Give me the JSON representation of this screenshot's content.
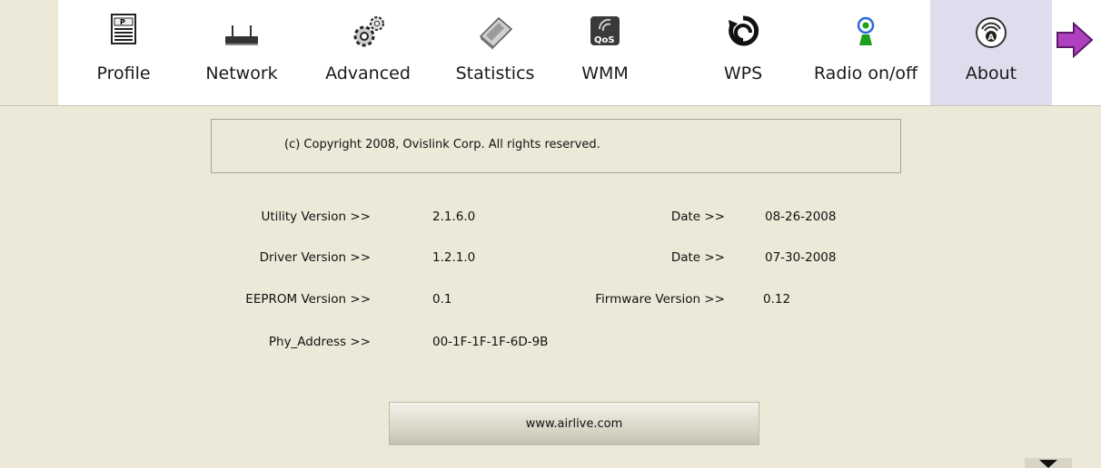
{
  "toolbar": {
    "items": [
      {
        "label": "Profile"
      },
      {
        "label": "Network"
      },
      {
        "label": "Advanced"
      },
      {
        "label": "Statistics"
      },
      {
        "label": "WMM"
      },
      {
        "label": "WPS"
      },
      {
        "label": "Radio on/off"
      },
      {
        "label": "About"
      }
    ],
    "selected": "About",
    "qos_badge": "QoS",
    "profile_badge": "P"
  },
  "about": {
    "copyright": "(c) Copyright 2008, Ovislink Corp. All rights reserved.",
    "utility_version_label": "Utility Version >>",
    "utility_version": "2.1.6.0",
    "utility_date_label": "Date >>",
    "utility_date": "08-26-2008",
    "driver_version_label": "Driver Version >>",
    "driver_version": "1.2.1.0",
    "driver_date_label": "Date >>",
    "driver_date": "07-30-2008",
    "eeprom_version_label": "EEPROM Version >>",
    "eeprom_version": "0.1",
    "firmware_version_label": "Firmware Version >>",
    "firmware_version": "0.12",
    "phy_address_label": "Phy_Address >>",
    "phy_address": "00-1F-1F-1F-6D-9B",
    "website": "www.airlive.com"
  },
  "colors": {
    "background": "#ece9d8",
    "toolbar": "#ffffff",
    "selected_tab": "#ddddee",
    "arrow": "#b040c0"
  },
  "icons": [
    "profile-icon",
    "network-icon",
    "advanced-icon",
    "statistics-icon",
    "wmm-icon",
    "wps-icon",
    "radio-icon",
    "about-icon",
    "next-arrow-icon",
    "scroll-down-icon"
  ]
}
